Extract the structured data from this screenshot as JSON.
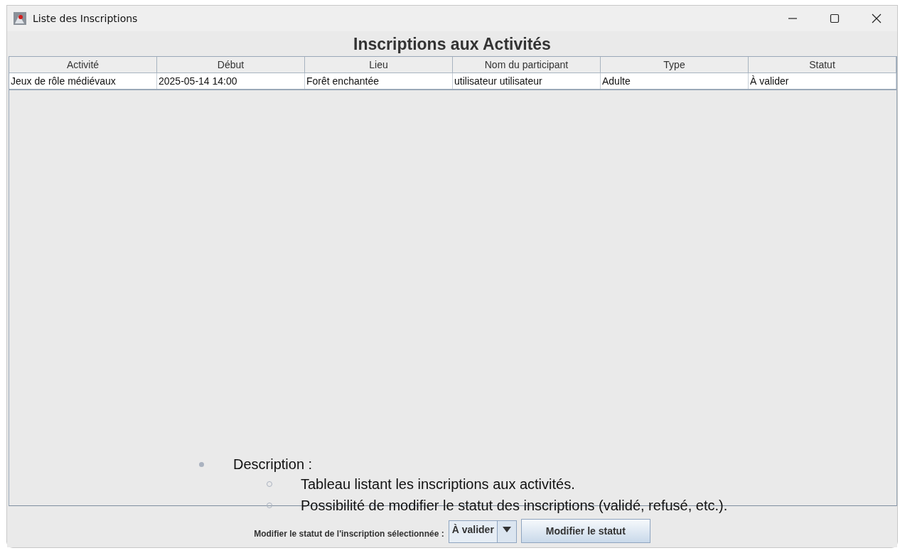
{
  "window": {
    "title": "Liste des Inscriptions"
  },
  "heading": "Inscriptions aux Activités",
  "table": {
    "columns": [
      "Activité",
      "Début",
      "Lieu",
      "Nom du participant",
      "Type",
      "Statut"
    ],
    "rows": [
      [
        "Jeux de rôle médiévaux",
        "2025-05-14 14:00",
        "Forêt enchantée",
        "utilisateur utilisateur",
        "Adulte",
        "À valider"
      ]
    ]
  },
  "footer": {
    "label": "Modifier le statut de l'inscription sélectionnée :",
    "combo_value": "À valider",
    "button": "Modifier le statut"
  },
  "overlay_notes": {
    "title": "Description :",
    "items": [
      "Tableau listant les inscriptions aux activités.",
      "Possibilité de modifier le statut des inscriptions (validé, refusé, etc.)."
    ]
  }
}
